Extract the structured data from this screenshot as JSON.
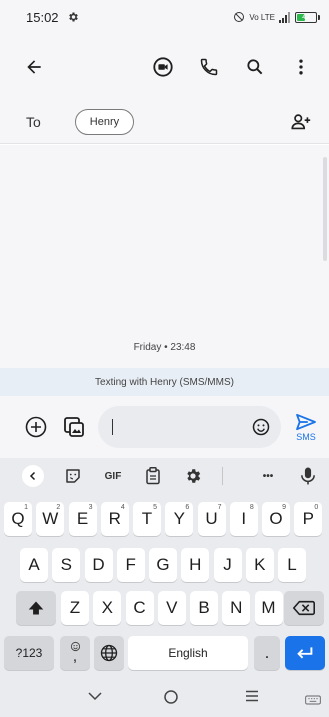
{
  "status_bar": {
    "time": "15:02",
    "network_label": "Vo LTE",
    "battery_level": "42",
    "battery_fraction": 0.42
  },
  "app_bar": {
    "icons": [
      "arrow-back-icon",
      "video-call-icon",
      "phone-icon",
      "search-icon",
      "more-vertical-icon"
    ]
  },
  "recipient": {
    "to_label": "To",
    "chip_name": "Henry"
  },
  "conversation": {
    "date_label": "Friday • 23:48",
    "info_banner": "Texting with Henry (SMS/MMS)"
  },
  "compose": {
    "send_label": "SMS"
  },
  "keyboard": {
    "toolbar_gif": "GIF",
    "toolbar_more": "•••",
    "row1": [
      {
        "key": "Q",
        "hint": "1"
      },
      {
        "key": "W",
        "hint": "2"
      },
      {
        "key": "E",
        "hint": "3"
      },
      {
        "key": "R",
        "hint": "4"
      },
      {
        "key": "T",
        "hint": "5"
      },
      {
        "key": "Y",
        "hint": "6"
      },
      {
        "key": "U",
        "hint": "7"
      },
      {
        "key": "I",
        "hint": "8"
      },
      {
        "key": "O",
        "hint": "9"
      },
      {
        "key": "P",
        "hint": "0"
      }
    ],
    "row2": [
      "A",
      "S",
      "D",
      "F",
      "G",
      "H",
      "J",
      "K",
      "L"
    ],
    "row3": [
      "Z",
      "X",
      "C",
      "V",
      "B",
      "N",
      "M"
    ],
    "symbols_key": "?123",
    "comma_key": ",",
    "space_label": "English",
    "period_key": "."
  },
  "colors": {
    "accent": "#1a73e8",
    "background": "#f6f6f8",
    "keyboard_bg": "#e9ebee",
    "battery": "#2db84d"
  }
}
